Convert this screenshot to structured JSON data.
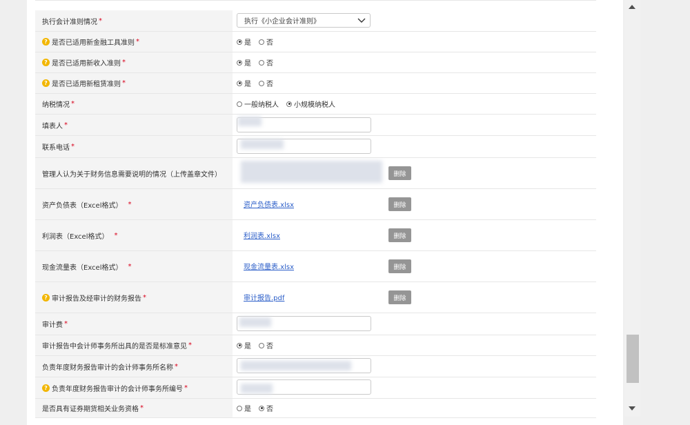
{
  "rows": {
    "r1": {
      "label": "执行会计准则情况",
      "req": "*",
      "select_value": "执行《小企业会计准则》"
    },
    "r2": {
      "label": "是否已适用新金融工具准则",
      "req": "*",
      "opt1": "是",
      "opt2": "否"
    },
    "r3": {
      "label": "是否已适用新收入准则",
      "req": "*",
      "opt1": "是",
      "opt2": "否"
    },
    "r4": {
      "label": "是否已适用新租赁准则",
      "req": "*",
      "opt1": "是",
      "opt2": "否"
    },
    "r5": {
      "label": "纳税情况",
      "req": "*",
      "opt1": "一般纳税人",
      "opt2": "小规模纳税人"
    },
    "r6": {
      "label": "填表人",
      "req": "*"
    },
    "r7": {
      "label": "联系电话",
      "req": "*"
    },
    "r8": {
      "label": "管理人认为关于财务信息需要说明的情况（上传盖章文件）",
      "delete_label": "删除"
    },
    "r9": {
      "label": "资产负债表（Excel格式）",
      "req": "*",
      "file": "资产负债表.xlsx",
      "delete_label": "删除"
    },
    "r10": {
      "label": "利润表（Excel格式）",
      "req": "*",
      "file": "利润表.xlsx",
      "delete_label": "删除"
    },
    "r11": {
      "label": "现金流量表（Excel格式）",
      "req": "*",
      "file": "现金流量表.xlsx",
      "delete_label": "删除"
    },
    "r12": {
      "label": "审计报告及经审计的财务报告",
      "req": "*",
      "file": "审计报告.pdf",
      "delete_label": "删除"
    },
    "r13": {
      "label": "审计费",
      "req": "*"
    },
    "r14": {
      "label": "审计报告中会计师事务所出具的是否是标准意见",
      "req": "*",
      "opt1": "是",
      "opt2": "否"
    },
    "r15": {
      "label": "负责年度财务报告审计的会计师事务所名称",
      "req": "*"
    },
    "r16": {
      "label": "负责年度财务报告审计的会计师事务所编号",
      "req": "*"
    },
    "r17": {
      "label": "是否具有证券期货相关业务资格",
      "req": "*",
      "opt1": "是",
      "opt2": "否"
    }
  },
  "help_glyph": "?",
  "colors": {
    "required": "#d9001b",
    "link": "#2a5dc8",
    "help_icon": "#f2b600",
    "delete_button": "#959595"
  }
}
